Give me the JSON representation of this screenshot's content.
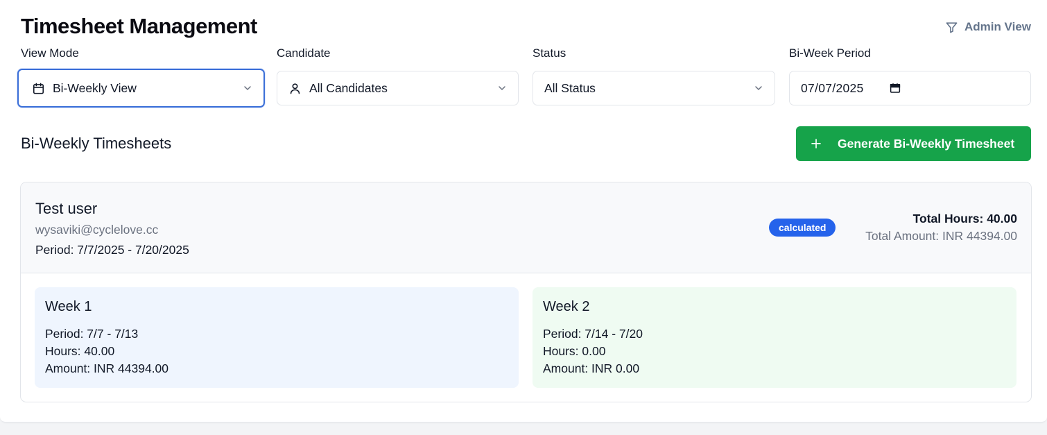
{
  "header": {
    "title": "Timesheet Management",
    "admin_view_label": "Admin View"
  },
  "filters": {
    "view_mode": {
      "label": "View Mode",
      "value": "Bi-Weekly View",
      "icon": "calendar-icon"
    },
    "candidate": {
      "label": "Candidate",
      "value": "All Candidates",
      "icon": "user-icon"
    },
    "status": {
      "label": "Status",
      "value": "All Status"
    },
    "period": {
      "label": "Bi-Week Period",
      "value": "07/07/2025"
    }
  },
  "section": {
    "title": "Bi-Weekly Timesheets",
    "generate_button": "Generate Bi-Weekly Timesheet"
  },
  "timesheet": {
    "name": "Test user",
    "email": "wysaviki@cyclelove.cc",
    "period": "Period: 7/7/2025 - 7/20/2025",
    "status": "calculated",
    "total_hours": "Total Hours: 40.00",
    "total_amount": "Total Amount: INR 44394.00",
    "weeks": [
      {
        "title": "Week 1",
        "period": "Period: 7/7 - 7/13",
        "hours": "Hours: 40.00",
        "amount": "Amount: INR 44394.00"
      },
      {
        "title": "Week 2",
        "period": "Period: 7/14 - 7/20",
        "hours": "Hours: 0.00",
        "amount": "Amount: INR 0.00"
      }
    ]
  },
  "colors": {
    "primary_green": "#16a34a",
    "badge_blue": "#2563eb",
    "focus_blue": "#3b6fd8",
    "week1_bg": "#eff5fe",
    "week2_bg": "#effbf2"
  }
}
